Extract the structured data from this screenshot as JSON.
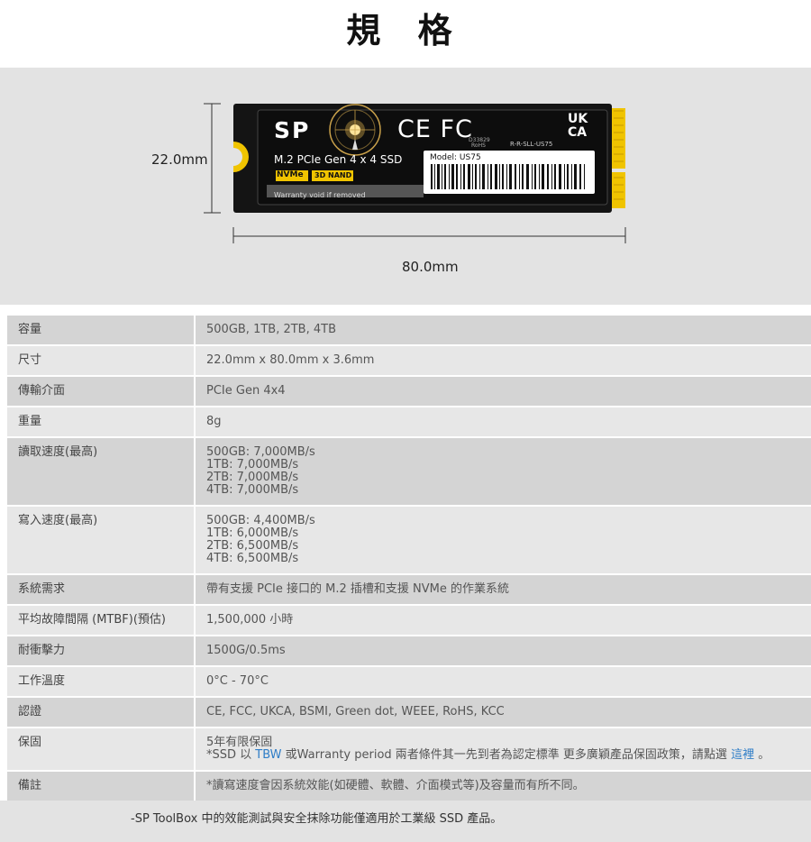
{
  "title": "規 格",
  "figure": {
    "height_label": "22.0mm",
    "width_label": "80.0mm",
    "ssd": {
      "brand": "SP",
      "interface_label": "M.2 PCIe Gen 4 x 4 SSD",
      "badge_nvme": "NVMe",
      "badge_3d": "3D NAND",
      "warranty_sticker": "Warranty void if removed",
      "model": "Model: US75",
      "cert_marks": "CE FC",
      "cert_code": "R-R-SLL-US75",
      "rohs": "RoHS",
      "uk": "UK",
      "ca": "CA",
      "cert_number": "D33829"
    },
    "colors": {
      "pcb": "#141414",
      "gold": "#f0c400",
      "sticker": "#0d0d0d"
    }
  },
  "specs": [
    {
      "label": "容量",
      "value": [
        "500GB, 1TB, 2TB, 4TB"
      ]
    },
    {
      "label": "尺寸",
      "value": [
        "22.0mm x 80.0mm x 3.6mm"
      ]
    },
    {
      "label": "傳輸介面",
      "value": [
        "PCIe Gen 4x4"
      ]
    },
    {
      "label": "重量",
      "value": [
        "8g"
      ]
    },
    {
      "label": "讀取速度(最高)",
      "value": [
        "500GB: 7,000MB/s",
        "1TB: 7,000MB/s",
        "2TB: 7,000MB/s",
        "4TB: 7,000MB/s"
      ]
    },
    {
      "label": "寫入速度(最高)",
      "value": [
        "500GB: 4,400MB/s",
        "1TB: 6,000MB/s",
        "2TB: 6,500MB/s",
        "4TB: 6,500MB/s"
      ]
    },
    {
      "label": "系統需求",
      "value": [
        "帶有支援 PCIe 接口的 M.2 插槽和支援 NVMe 的作業系統"
      ]
    },
    {
      "label": "平均故障間隔 (MTBF)(預估)",
      "value": [
        "1,500,000 小時"
      ]
    },
    {
      "label": "耐衝擊力",
      "value": [
        "1500G/0.5ms"
      ]
    },
    {
      "label": "工作溫度",
      "value": [
        "0°C - 70°C"
      ]
    },
    {
      "label": "認證",
      "value": [
        "CE, FCC, UKCA, BSMI, Green dot, WEEE, RoHS, KCC"
      ]
    },
    {
      "label": "保固",
      "value": [
        "5年有限保固"
      ],
      "warranty_note": {
        "prefix": "*SSD 以 ",
        "tbw": "TBW",
        "middle": " 或Warranty period 兩者條件其一先到者為認定標準 更多廣穎產品保固政策，請點選 ",
        "link": "這裡",
        "suffix": " 。"
      }
    },
    {
      "label": "備註",
      "value": [
        "*讀寫速度會因系統效能(如硬體、軟體、介面模式等)及容量而有所不同。"
      ]
    }
  ],
  "footer": "-SP ToolBox 中的效能測試與安全抹除功能僅適用於工業級 SSD 產品。"
}
